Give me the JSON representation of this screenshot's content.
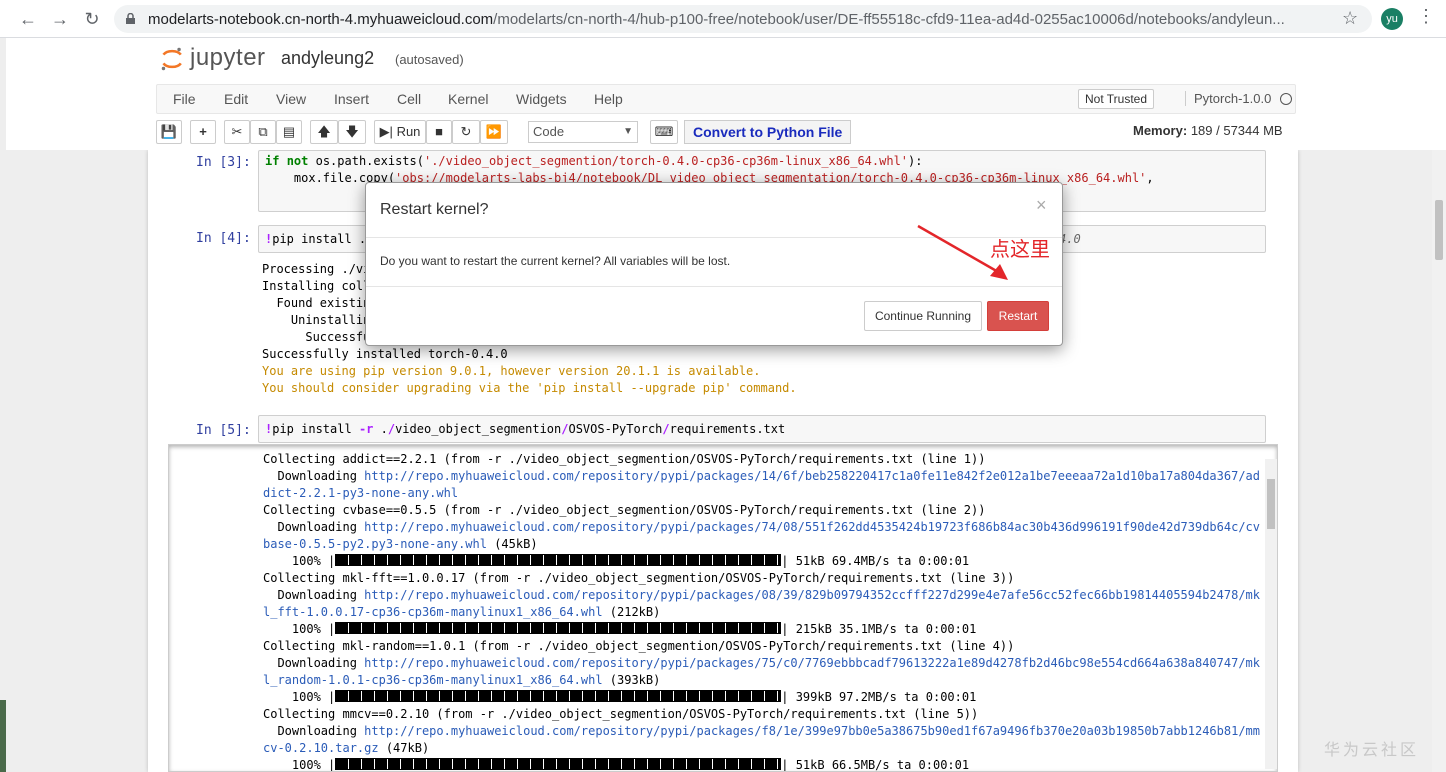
{
  "browser": {
    "url_host": "modelarts-notebook.cn-north-4.myhuaweicloud.com",
    "url_path": "/modelarts/cn-north-4/hub-p100-free/notebook/user/DE-ff55518c-cfd9-11ea-ad4d-0255ac10006d/notebooks/andyleun...",
    "avatar": "yu"
  },
  "header": {
    "logo_text": "jupyter",
    "notebook_name": "andyleung2",
    "autosave": "(autosaved)"
  },
  "menubar": {
    "items": [
      "File",
      "Edit",
      "View",
      "Insert",
      "Cell",
      "Kernel",
      "Widgets",
      "Help"
    ],
    "not_trusted": "Not Trusted",
    "kernel": "Pytorch-1.0.0"
  },
  "toolbar": {
    "run_label": "Run",
    "cell_type": "Code",
    "convert_label": "Convert to Python File",
    "memory_label": "Memory:",
    "memory_value": "189 / 57344 MB"
  },
  "cells": {
    "c3_prompt": "In  [3]:",
    "c4_prompt": "In  [4]:",
    "c5_prompt": "In  [5]:",
    "c4_input_tail": "4.0",
    "c4_out": [
      "Processing ./vi",
      "Installing coll",
      "  Found existin",
      "    Uninstallin",
      "      Successfu",
      "Successfully installed torch-0.4.0"
    ],
    "c4_warn": [
      "You are using pip version 9.0.1, however version 20.1.1 is available.",
      "You should consider upgrading via the 'pip install --upgrade pip' command."
    ]
  },
  "output5": [
    {
      "t": "Collecting addict==2.2.1 (from -r ./video_object_segmention/OSVOS-PyTorch/requirements.txt (line 1))"
    },
    {
      "p": "  Downloading ",
      "l": "http://repo.myhuaweicloud.com/repository/pypi/packages/14/6f/beb258220417c1a0fe11e842f2e012a1be7eeeaa72a1d10ba17a804da367/ad"
    },
    {
      "l": "dict-2.2.1-py3-none-any.whl"
    },
    {
      "t": "Collecting cvbase==0.5.5 (from -r ./video_object_segmention/OSVOS-PyTorch/requirements.txt (line 2))"
    },
    {
      "p": "  Downloading ",
      "l": "http://repo.myhuaweicloud.com/repository/pypi/packages/74/08/551f262dd4535424b19723f686b84ac30b436d996191f90de42d739db64c/cv"
    },
    {
      "l": "base-0.5.5-py2.py3-none-any.whl",
      "s": " (45kB)"
    },
    {
      "bar": "51kB 69.4MB/s ta 0:00:01"
    },
    {
      "t": "Collecting mkl-fft==1.0.0.17 (from -r ./video_object_segmention/OSVOS-PyTorch/requirements.txt (line 3))"
    },
    {
      "p": "  Downloading ",
      "l": "http://repo.myhuaweicloud.com/repository/pypi/packages/08/39/829b09794352ccfff227d299e4e7afe56cc52fec66bb19814405594b2478/mk"
    },
    {
      "l": "l_fft-1.0.0.17-cp36-cp36m-manylinux1_x86_64.whl",
      "s": " (212kB)"
    },
    {
      "bar": "215kB 35.1MB/s ta 0:00:01"
    },
    {
      "t": "Collecting mkl-random==1.0.1 (from -r ./video_object_segmention/OSVOS-PyTorch/requirements.txt (line 4))"
    },
    {
      "p": "  Downloading ",
      "l": "http://repo.myhuaweicloud.com/repository/pypi/packages/75/c0/7769ebbbcadf79613222a1e89d4278fb2d46bc98e554cd664a638a840747/mk"
    },
    {
      "l": "l_random-1.0.1-cp36-cp36m-manylinux1_x86_64.whl",
      "s": " (393kB)"
    },
    {
      "bar": "399kB 97.2MB/s ta 0:00:01"
    },
    {
      "t": "Collecting mmcv==0.2.10 (from -r ./video_object_segmention/OSVOS-PyTorch/requirements.txt (line 5))"
    },
    {
      "p": "  Downloading ",
      "l": "http://repo.myhuaweicloud.com/repository/pypi/packages/f8/1e/399e97bb0e5a38675b90ed1f67a9496fb370e20a03b19850b7abb1246b81/mm"
    },
    {
      "l": "cv-0.2.10.tar.gz",
      "s": " (47kB)"
    },
    {
      "bar": "51kB 66.5MB/s ta 0:00:01"
    }
  ],
  "modal": {
    "title": "Restart kernel?",
    "close": "×",
    "body": "Do you want to restart the current kernel? All variables will be lost.",
    "continue_label": "Continue Running",
    "restart_label": "Restart"
  },
  "annotation": "点这里",
  "watermark": "华为云社区",
  "colors": {
    "restart": "#d9534f",
    "annotation": "#e3262a",
    "prompt": "#303f9f"
  }
}
